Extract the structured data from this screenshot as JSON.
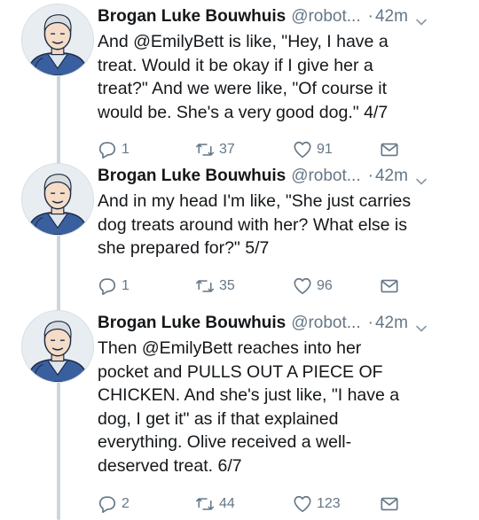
{
  "tweets": [
    {
      "name": "Brogan Luke Bouwhuis",
      "handle": "@robot...",
      "dot": "·",
      "time": "42m",
      "lines": [
        [
          {
            "t": "And "
          },
          {
            "t": "@EmilyBett",
            "m": true
          },
          {
            "t": " is like, \"Hey, I have a"
          }
        ],
        [
          {
            "t": "treat. Would it be okay if I give her a"
          }
        ],
        [
          {
            "t": "treat?\" And we were like, \"Of course it"
          }
        ],
        [
          {
            "t": "would be. She's a very good dog.\" 4/7"
          }
        ]
      ],
      "replies": "1",
      "retweets": "37",
      "likes": "91"
    },
    {
      "name": "Brogan Luke Bouwhuis",
      "handle": "@robot...",
      "dot": "·",
      "time": "42m",
      "lines": [
        [
          {
            "t": "And in my head I'm like, \"She just carries"
          }
        ],
        [
          {
            "t": "dog treats around with her? What else is"
          }
        ],
        [
          {
            "t": "she prepared for?\" 5/7"
          }
        ]
      ],
      "replies": "1",
      "retweets": "35",
      "likes": "96"
    },
    {
      "name": "Brogan Luke Bouwhuis",
      "handle": "@robot...",
      "dot": "·",
      "time": "42m",
      "lines": [
        [
          {
            "t": "Then "
          },
          {
            "t": "@EmilyBett",
            "m": true
          },
          {
            "t": " reaches into her"
          }
        ],
        [
          {
            "t": "pocket and PULLS OUT A PIECE OF"
          }
        ],
        [
          {
            "t": "CHICKEN. And she's just like, \"I have a"
          }
        ],
        [
          {
            "t": "dog, I get it\" as if that explained"
          }
        ],
        [
          {
            "t": "everything. Olive received a well-"
          }
        ],
        [
          {
            "t": "deserved treat. 6/7"
          }
        ]
      ],
      "replies": "2",
      "retweets": "44",
      "likes": "123"
    }
  ],
  "icons": {
    "reply": "reply-icon",
    "retweet": "retweet-icon",
    "like": "heart-icon",
    "dm": "envelope-icon",
    "more": "chevron-down-icon"
  },
  "colors": {
    "mention": "#1b95e0",
    "secondary_text": "#657786",
    "thread_line": "#ccd6dd"
  }
}
